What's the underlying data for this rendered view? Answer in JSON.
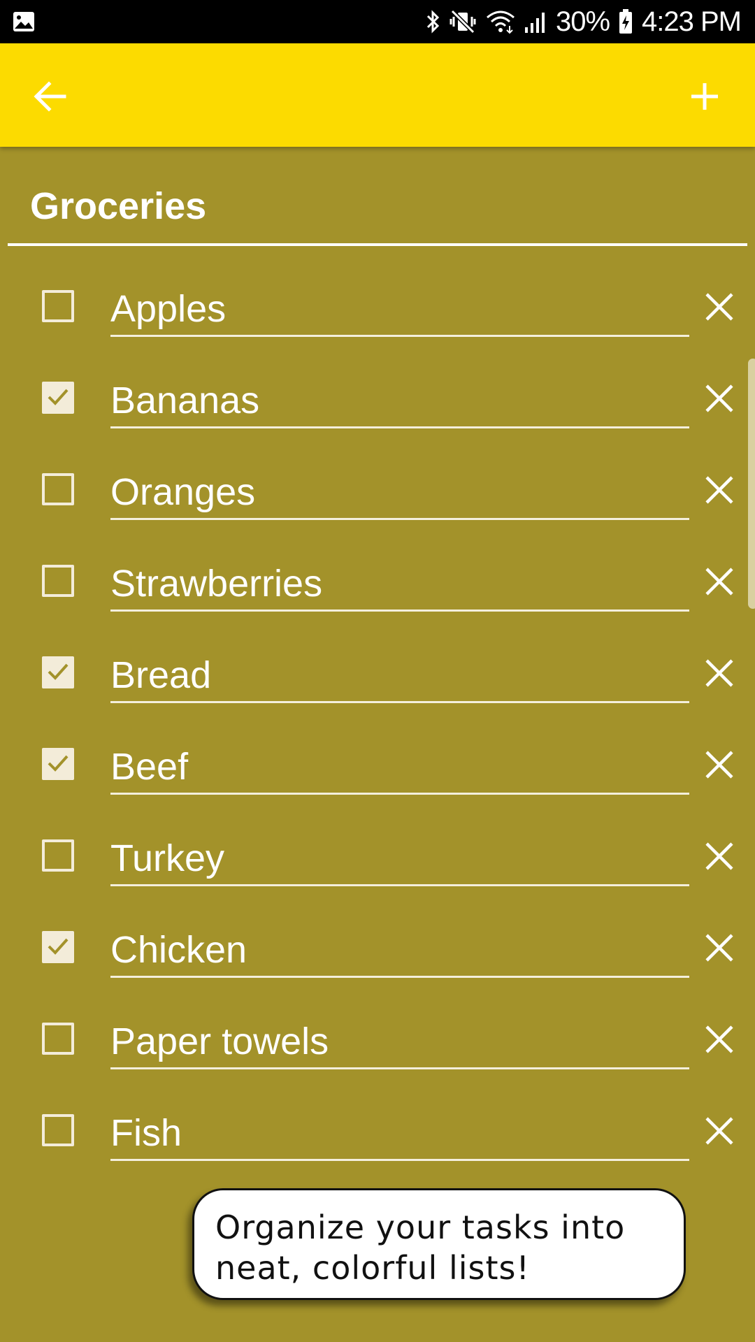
{
  "status_bar": {
    "battery": "30%",
    "time": "4:23 PM",
    "icons": [
      "gallery-icon",
      "bluetooth-icon",
      "vibrate-mute-icon",
      "wifi-icon",
      "signal-icon",
      "battery-icon"
    ]
  },
  "toolbar": {
    "background": "#fcdb00",
    "back_icon": "arrow-left-icon",
    "add_icon": "plus-icon"
  },
  "list": {
    "title": "Groceries",
    "background": "#a3922a",
    "items": [
      {
        "label": "Apples",
        "checked": false
      },
      {
        "label": "Bananas",
        "checked": true
      },
      {
        "label": "Oranges",
        "checked": false
      },
      {
        "label": "Strawberries",
        "checked": false
      },
      {
        "label": "Bread",
        "checked": true
      },
      {
        "label": "Beef",
        "checked": true
      },
      {
        "label": "Turkey",
        "checked": false
      },
      {
        "label": "Chicken",
        "checked": true
      },
      {
        "label": "Paper towels",
        "checked": false
      },
      {
        "label": "Fish",
        "checked": false
      }
    ]
  },
  "promo": {
    "line1": "Organize your tasks into",
    "line2": "neat, colorful lists!"
  }
}
